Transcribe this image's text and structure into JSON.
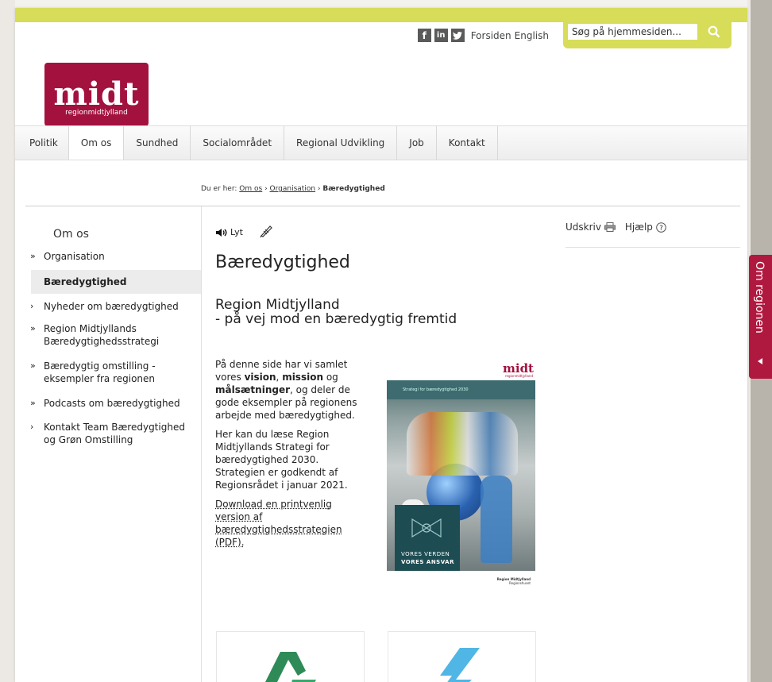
{
  "header": {
    "social": [
      "f",
      "in",
      "t"
    ],
    "links": [
      "Forsiden",
      "English"
    ],
    "search": {
      "placeholder": "Søg på hjemmesiden..."
    }
  },
  "logo": {
    "big": "midt",
    "small": "regionmidtjylland"
  },
  "nav": {
    "items": [
      "Politik",
      "Om os",
      "Sundhed",
      "Socialområdet",
      "Regional Udvikling",
      "Job",
      "Kontakt"
    ],
    "active_index": 1
  },
  "breadcrumb": {
    "prefix": "Du er her:",
    "items": [
      "Om os",
      "Organisation"
    ],
    "current": "Bæredygtighed"
  },
  "sidebar": {
    "title": "Om os",
    "items": [
      {
        "marker": "»",
        "label": "Organisation"
      },
      {
        "marker": "",
        "label": "Bæredygtighed",
        "active": true
      },
      {
        "marker": "›",
        "label": "Nyheder om bæredygtighed"
      },
      {
        "marker": "»",
        "label": "Region Midtjyllands Bæredygtighedsstrategi"
      },
      {
        "marker": "»",
        "label": "Bæredygtig omstilling - eksempler fra regionen"
      },
      {
        "marker": "»",
        "label": "Podcasts om bæredygtighed"
      },
      {
        "marker": "›",
        "label": "Kontakt Team Bæredygtighed og Grøn Omstilling"
      }
    ]
  },
  "tools": {
    "listen": "Lyt"
  },
  "main": {
    "title": "Bæredygtighed",
    "subtitle_line1": "Region Midtjylland",
    "subtitle_line2": "- på vej mod en bæredygtig fremtid",
    "p1_a": "På denne side har vi samlet vores ",
    "p1_b1": "vision",
    "p1_c": ", ",
    "p1_b2": "mission",
    "p1_d": " og ",
    "p1_b3": "målsætninger",
    "p1_e": ", og deler de gode eksempler på regionens arbejde med bæredygtighed.",
    "p2": "Her kan du læse Region Midtjyllands Strategi for bæredygtighed 2030. Strategien er godkendt af Regionsrådet i januar 2021.",
    "download_link": "Download en printvenlig version af bæredygtighedsstrategien (PDF)."
  },
  "cover": {
    "logo": "midt",
    "logo_small": "regionmidtjylland",
    "band_text": "Strategi for bæredygtighed 2030",
    "box_line1": "VORES VERDEN",
    "box_line2": "VORES ANSVAR",
    "bottom_line1": "Region Midtjylland",
    "bottom_line2": "Regionshuset"
  },
  "right": {
    "print": "Udskriv",
    "help": "Hjælp"
  },
  "side_tab": {
    "label": "Om regionen"
  },
  "colors": {
    "brand": "#a3123f",
    "accent": "#d7dc59",
    "tab": "#b0193f"
  }
}
